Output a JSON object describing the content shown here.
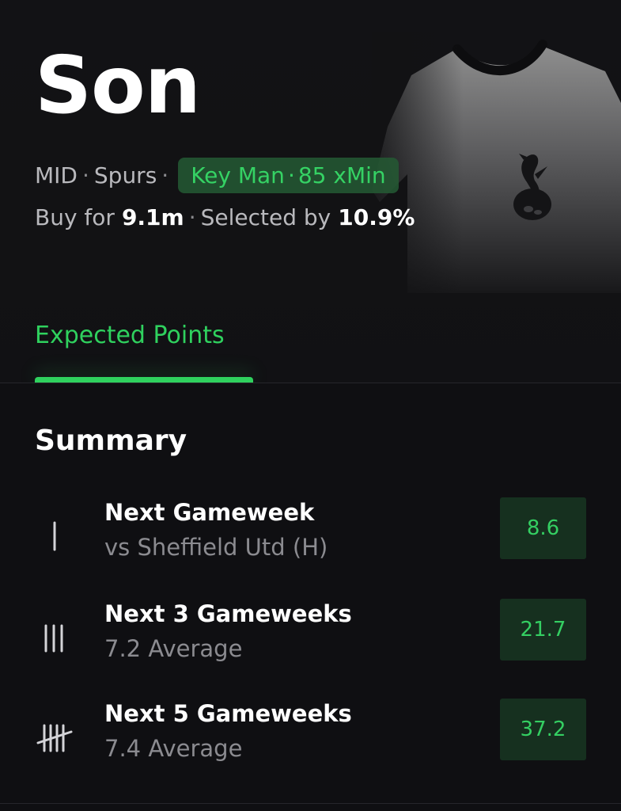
{
  "player": {
    "name": "Son",
    "position": "MID",
    "team": "Spurs",
    "badge": {
      "role": "Key Man",
      "minutes": "85 xMin"
    },
    "buy_label": "Buy for",
    "price": "9.1m",
    "selected_label": "Selected by",
    "selected_pct": "10.9%"
  },
  "tabs": [
    {
      "label": "Expected Points",
      "active": true
    }
  ],
  "summary": {
    "title": "Summary",
    "rows": [
      {
        "title": "Next Gameweek",
        "subtitle": "vs Sheffield Utd (H)",
        "value": "8.6",
        "icon": "tally-1-icon"
      },
      {
        "title": "Next 3 Gameweeks",
        "subtitle": "7.2 Average",
        "value": "21.7",
        "icon": "tally-3-icon"
      },
      {
        "title": "Next 5 Gameweeks",
        "subtitle": "7.4 Average",
        "value": "37.2",
        "icon": "tally-5-icon"
      }
    ]
  },
  "colors": {
    "accent": "#2fd15e",
    "badge_bg": "#245a34",
    "background": "#0f0f12",
    "score_bg": "#16301f"
  },
  "icons": {
    "shirt": "spurs-shirt-icon",
    "crest": "cockerel-crest-icon"
  }
}
